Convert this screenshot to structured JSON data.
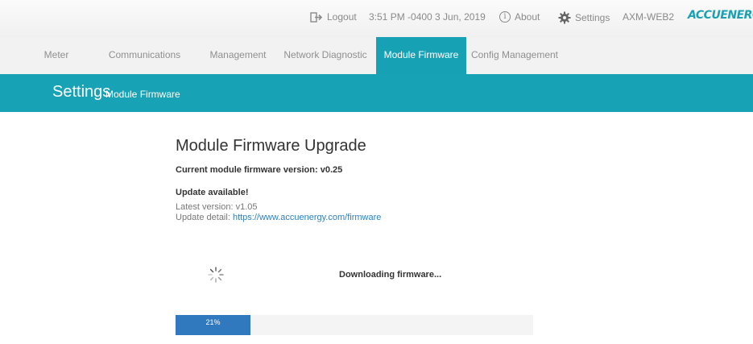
{
  "topbar": {
    "logout_label": "Logout",
    "datetime": "3:51 PM -0400 3 Jun, 2019",
    "about_label": "About",
    "settings_label": "Settings",
    "device_name": "AXM-WEB2",
    "brand": "ACCUENERGY"
  },
  "nav": {
    "tabs": [
      {
        "label": "Meter"
      },
      {
        "label": "Communications"
      },
      {
        "label": "Management"
      },
      {
        "label": "Network Diagnostic"
      },
      {
        "label": "Module Firmware",
        "active": true
      },
      {
        "label": "Config Management"
      }
    ]
  },
  "header": {
    "title": "Settings",
    "subtitle": "Module Firmware"
  },
  "main": {
    "heading": "Module Firmware Upgrade",
    "current_version_text": "Current module firmware version: v0.25",
    "update_available": "Update available!",
    "latest_label": "Latest version:",
    "latest_value": "v1.05",
    "detail_label": "Update detail:",
    "detail_link": "https://www.accuenergy.com/firmware",
    "status_text": "Downloading firmware...",
    "progress_label": "21%",
    "progress_fraction": 0.21
  },
  "colors": {
    "accent": "#17a3b5",
    "progress": "#3079be",
    "link": "#2f7fc0"
  },
  "icons": [
    "logout-icon",
    "info-icon",
    "gear-icon",
    "spinner-icon"
  ]
}
